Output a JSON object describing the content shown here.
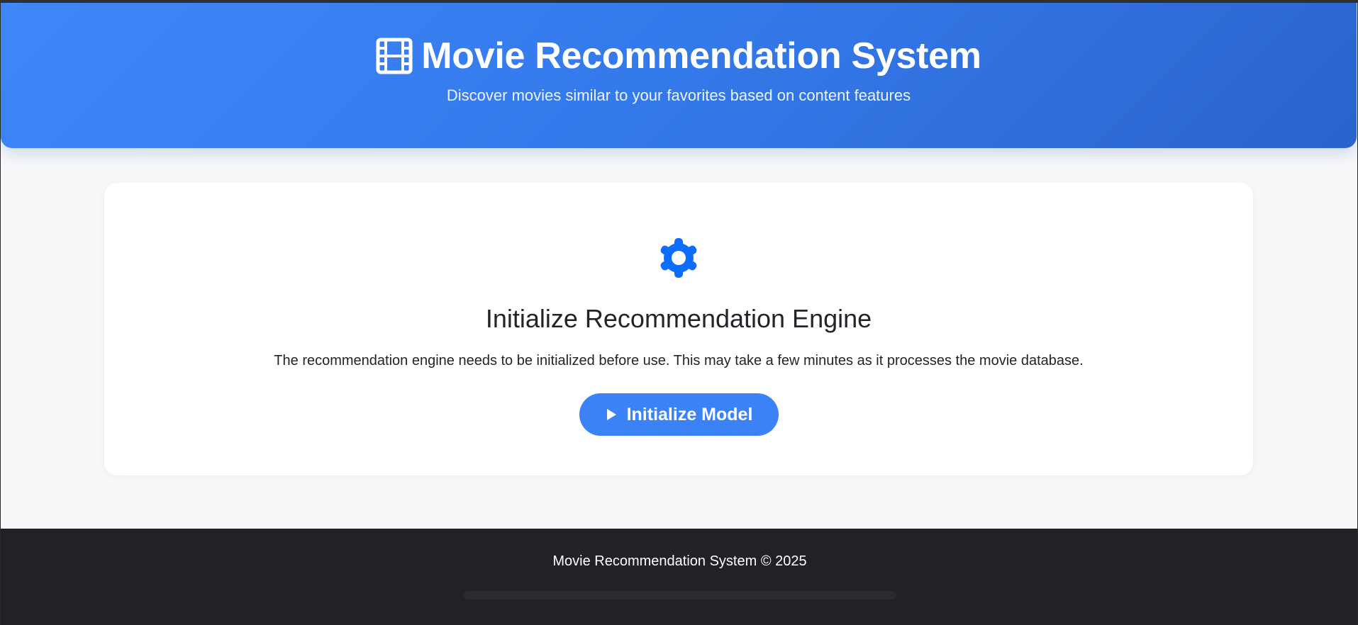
{
  "header": {
    "title": "Movie Recommendation System",
    "subtitle": "Discover movies similar to your favorites based on content features",
    "icon": "film-icon"
  },
  "card": {
    "icon": "gear-icon",
    "title": "Initialize Recommendation Engine",
    "description": "The recommendation engine needs to be initialized before use. This may take a few minutes as it processes the movie database.",
    "button_label": "Initialize Model",
    "button_icon": "play-icon"
  },
  "footer": {
    "text": "Movie Recommendation System © 2025"
  },
  "colors": {
    "accent": "#3b82f6",
    "header_gradient_start": "#3d87fb",
    "header_gradient_end": "#2a64cc",
    "footer_bg": "#212226",
    "page_bg": "#f7f8fa",
    "text_dark": "#212529"
  }
}
